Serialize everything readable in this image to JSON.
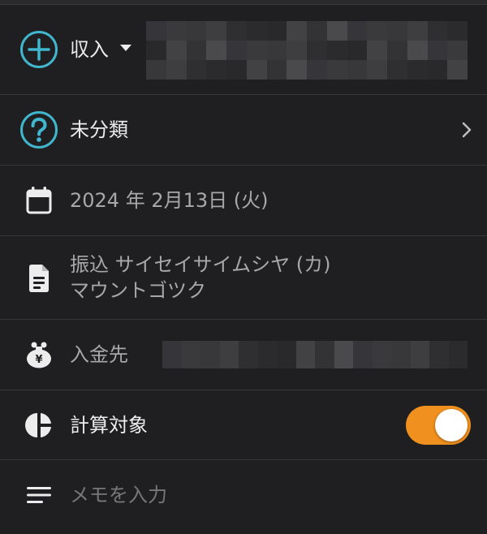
{
  "type_selector": {
    "label": "収入",
    "icon": "plus-circle-icon"
  },
  "category": {
    "label": "未分類",
    "icon": "question-circle-icon"
  },
  "date": {
    "text": "2024 年 2月13日 (火)",
    "icon": "calendar-icon"
  },
  "description": {
    "line1": "振込 サイセイサイムシヤ (カ)",
    "line2": "マウントゴツク",
    "icon": "document-icon"
  },
  "deposit_account": {
    "label": "入金先",
    "icon": "money-bag-icon"
  },
  "calculation": {
    "label": "計算対象",
    "enabled": true,
    "icon": "pie-chart-icon"
  },
  "memo": {
    "placeholder": "メモを入力",
    "icon": "lines-icon"
  },
  "colors": {
    "accent_icon": "#41b6cf",
    "toggle_on": "#f0901e",
    "background": "#1f1f21"
  }
}
